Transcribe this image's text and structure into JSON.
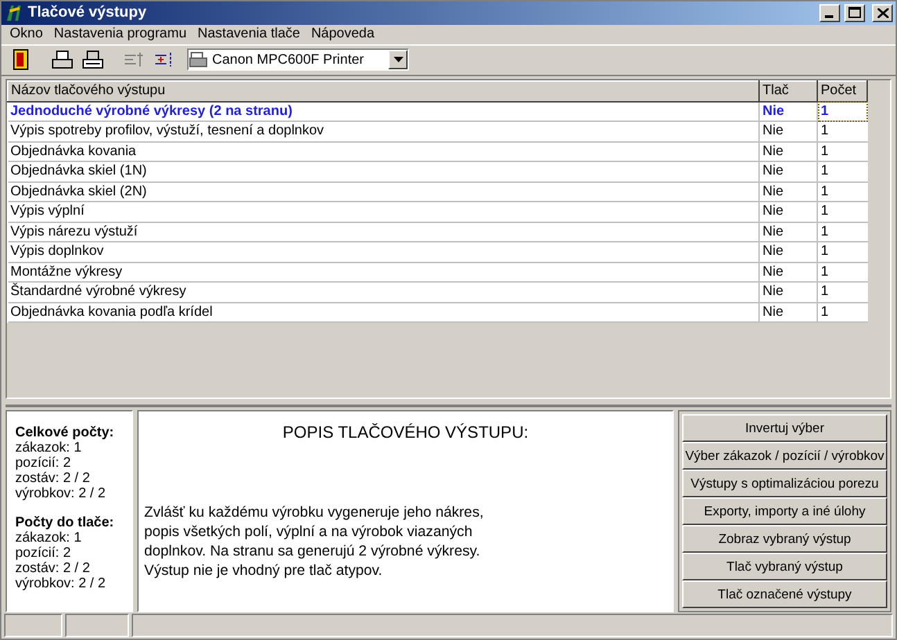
{
  "window": {
    "title": "Tlačové výstupy"
  },
  "menu": [
    "Okno",
    "Nastavenia programu",
    "Nastavenia tlače",
    "Nápoveda"
  ],
  "toolbar": {
    "printer": "Canon MPC600F Printer"
  },
  "table": {
    "columns": [
      "Názov tlačového výstupu",
      "Tlač",
      "Počet"
    ],
    "rows": [
      {
        "name": "Jednoduché výrobné výkresy (2 na stranu)",
        "print": "Nie",
        "count": "1",
        "selected": true
      },
      {
        "name": "Výpis spotreby profilov, výstuží, tesnení a doplnkov",
        "print": "Nie",
        "count": "1",
        "selected": false
      },
      {
        "name": "Objednávka kovania",
        "print": "Nie",
        "count": "1",
        "selected": false
      },
      {
        "name": "Objednávka skiel (1N)",
        "print": "Nie",
        "count": "1",
        "selected": false
      },
      {
        "name": "Objednávka skiel (2N)",
        "print": "Nie",
        "count": "1",
        "selected": false
      },
      {
        "name": "Výpis výplní",
        "print": "Nie",
        "count": "1",
        "selected": false
      },
      {
        "name": "Výpis nárezu výstuží",
        "print": "Nie",
        "count": "1",
        "selected": false
      },
      {
        "name": "Výpis doplnkov",
        "print": "Nie",
        "count": "1",
        "selected": false
      },
      {
        "name": "Montážne výkresy",
        "print": "Nie",
        "count": "1",
        "selected": false
      },
      {
        "name": "Štandardné výrobné výkresy",
        "print": "Nie",
        "count": "1",
        "selected": false
      },
      {
        "name": "Objednávka kovania podľa krídel",
        "print": "Nie",
        "count": "1",
        "selected": false
      }
    ]
  },
  "counts": [
    {
      "heading": "Celkové počty:",
      "lines": [
        "zákazok: 1",
        "pozícií: 2",
        "zostáv: 2 / 2",
        "výrobkov: 2 / 2"
      ]
    },
    {
      "heading": "Počty do tlače:",
      "lines": [
        "zákazok: 1",
        "pozícií: 2",
        "zostáv: 2 / 2",
        "výrobkov: 2 / 2"
      ]
    }
  ],
  "description": {
    "title": "POPIS TLAČOVÉHO VÝSTUPU:",
    "text": "Zvlášť ku každému výrobku vygeneruje jeho nákres, popis všetkých polí, výplní a na výrobok viazaných doplnkov. Na stranu sa generujú 2 výrobné výkresy. Výstup nie je vhodný pre tlač atypov."
  },
  "buttons": [
    "Invertuj výber",
    "Výber zákazok / pozícií / výrobkov",
    "Výstupy s optimalizáciou porezu",
    "Exporty, importy a iné úlohy",
    "Zobraz vybraný výstup",
    "Tlač vybraný výstup",
    "Tlač označené výstupy"
  ]
}
